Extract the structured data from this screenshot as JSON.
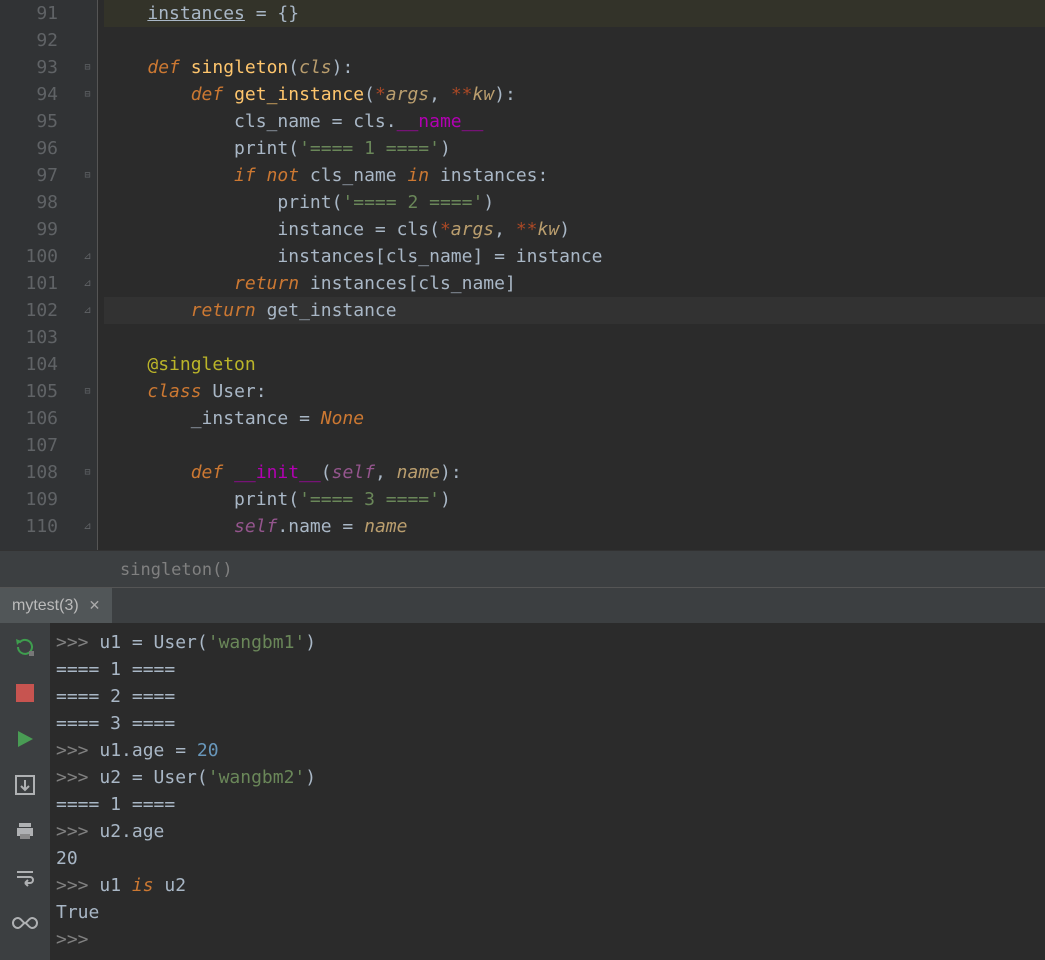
{
  "editor": {
    "lines": [
      {
        "n": 91,
        "fold": "",
        "tokens": [
          {
            "t": "    ",
            "c": ""
          },
          {
            "t": "instances",
            "c": "var und"
          },
          {
            "t": " = {}",
            "c": "op"
          }
        ],
        "hl": true
      },
      {
        "n": 92,
        "fold": "",
        "tokens": []
      },
      {
        "n": 93,
        "fold": "⊟",
        "tokens": [
          {
            "t": "    ",
            "c": ""
          },
          {
            "t": "def ",
            "c": "kw"
          },
          {
            "t": "singleton",
            "c": "def"
          },
          {
            "t": "(",
            "c": "op"
          },
          {
            "t": "cls",
            "c": "pname"
          },
          {
            "t": "):",
            "c": "op"
          }
        ]
      },
      {
        "n": 94,
        "fold": "⊟",
        "tokens": [
          {
            "t": "        ",
            "c": ""
          },
          {
            "t": "def ",
            "c": "kw"
          },
          {
            "t": "get_instance",
            "c": "def"
          },
          {
            "t": "(",
            "c": "op"
          },
          {
            "t": "*",
            "c": "par"
          },
          {
            "t": "args",
            "c": "pname"
          },
          {
            "t": ", ",
            "c": "op"
          },
          {
            "t": "**",
            "c": "par"
          },
          {
            "t": "kw",
            "c": "pname"
          },
          {
            "t": "):",
            "c": "op"
          }
        ]
      },
      {
        "n": 95,
        "fold": "",
        "tokens": [
          {
            "t": "            cls_name = cls.",
            "c": "var"
          },
          {
            "t": "__name__",
            "c": "fn"
          }
        ]
      },
      {
        "n": 96,
        "fold": "",
        "tokens": [
          {
            "t": "            ",
            "c": ""
          },
          {
            "t": "print",
            "c": "call"
          },
          {
            "t": "(",
            "c": "op"
          },
          {
            "t": "'==== 1 ===='",
            "c": "str"
          },
          {
            "t": ")",
            "c": "op"
          }
        ]
      },
      {
        "n": 97,
        "fold": "⊟",
        "tokens": [
          {
            "t": "            ",
            "c": ""
          },
          {
            "t": "if not ",
            "c": "kw"
          },
          {
            "t": "cls_name ",
            "c": "var"
          },
          {
            "t": "in ",
            "c": "kw"
          },
          {
            "t": "instances:",
            "c": "var"
          }
        ]
      },
      {
        "n": 98,
        "fold": "",
        "tokens": [
          {
            "t": "                ",
            "c": ""
          },
          {
            "t": "print",
            "c": "call"
          },
          {
            "t": "(",
            "c": "op"
          },
          {
            "t": "'==== 2 ===='",
            "c": "str"
          },
          {
            "t": ")",
            "c": "op"
          }
        ]
      },
      {
        "n": 99,
        "fold": "",
        "tokens": [
          {
            "t": "                instance = cls(",
            "c": "var"
          },
          {
            "t": "*",
            "c": "par"
          },
          {
            "t": "args",
            "c": "pname"
          },
          {
            "t": ", ",
            "c": "op"
          },
          {
            "t": "**",
            "c": "par"
          },
          {
            "t": "kw",
            "c": "pname"
          },
          {
            "t": ")",
            "c": "op"
          }
        ]
      },
      {
        "n": 100,
        "fold": "⊿",
        "tokens": [
          {
            "t": "                instances[cls_name] = instance",
            "c": "var"
          }
        ]
      },
      {
        "n": 101,
        "fold": "⊿",
        "tokens": [
          {
            "t": "            ",
            "c": ""
          },
          {
            "t": "return ",
            "c": "kw"
          },
          {
            "t": "instances[cls_name]",
            "c": "var"
          }
        ]
      },
      {
        "n": 102,
        "fold": "⊿",
        "tokens": [
          {
            "t": "        ",
            "c": ""
          },
          {
            "t": "return ",
            "c": "kw"
          },
          {
            "t": "get_instance",
            "c": "var"
          }
        ],
        "cur": true
      },
      {
        "n": 103,
        "fold": "",
        "tokens": []
      },
      {
        "n": 104,
        "fold": "",
        "tokens": [
          {
            "t": "    ",
            "c": ""
          },
          {
            "t": "@singleton",
            "c": "dec"
          }
        ]
      },
      {
        "n": 105,
        "fold": "⊟",
        "tokens": [
          {
            "t": "    ",
            "c": ""
          },
          {
            "t": "class ",
            "c": "kw"
          },
          {
            "t": "User",
            "c": "cls"
          },
          {
            "t": ":",
            "c": "op"
          }
        ]
      },
      {
        "n": 106,
        "fold": "",
        "tokens": [
          {
            "t": "        _instance = ",
            "c": "var"
          },
          {
            "t": "None",
            "c": "none"
          }
        ]
      },
      {
        "n": 107,
        "fold": "",
        "tokens": []
      },
      {
        "n": 108,
        "fold": "⊟",
        "tokens": [
          {
            "t": "        ",
            "c": ""
          },
          {
            "t": "def ",
            "c": "kw"
          },
          {
            "t": "__init__",
            "c": "fn"
          },
          {
            "t": "(",
            "c": "op"
          },
          {
            "t": "self",
            "c": "self"
          },
          {
            "t": ", ",
            "c": "op"
          },
          {
            "t": "name",
            "c": "pname"
          },
          {
            "t": "):",
            "c": "op"
          }
        ]
      },
      {
        "n": 109,
        "fold": "",
        "tokens": [
          {
            "t": "            ",
            "c": ""
          },
          {
            "t": "print",
            "c": "call"
          },
          {
            "t": "(",
            "c": "op"
          },
          {
            "t": "'==== 3 ===='",
            "c": "str"
          },
          {
            "t": ")",
            "c": "op"
          }
        ]
      },
      {
        "n": 110,
        "fold": "⊿",
        "tokens": [
          {
            "t": "            ",
            "c": ""
          },
          {
            "t": "self",
            "c": "self"
          },
          {
            "t": ".name = ",
            "c": "var"
          },
          {
            "t": "name",
            "c": "pname"
          }
        ]
      }
    ]
  },
  "breadcrumb": "singleton()",
  "tab": {
    "label": "mytest(3)",
    "close": "✕"
  },
  "toolbar_icons": [
    "rerun-icon",
    "stop-icon",
    "play-icon",
    "layout-icon",
    "print-icon",
    "wrap-icon",
    "infinite-icon"
  ],
  "console": {
    "lines": [
      [
        {
          "t": ">>> ",
          "c": "prompt"
        },
        {
          "t": "u1 = User(",
          "c": ""
        },
        {
          "t": "'wangbm1'",
          "c": "c-str"
        },
        {
          "t": ")",
          "c": ""
        }
      ],
      [
        {
          "t": "==== 1 ====",
          "c": ""
        }
      ],
      [
        {
          "t": "==== 2 ====",
          "c": ""
        }
      ],
      [
        {
          "t": "==== 3 ====",
          "c": ""
        }
      ],
      [
        {
          "t": ">>> ",
          "c": "prompt"
        },
        {
          "t": "u1.age = ",
          "c": ""
        },
        {
          "t": "20",
          "c": "c-num"
        }
      ],
      [
        {
          "t": ">>> ",
          "c": "prompt"
        },
        {
          "t": "u2 = User(",
          "c": ""
        },
        {
          "t": "'wangbm2'",
          "c": "c-str"
        },
        {
          "t": ")",
          "c": ""
        }
      ],
      [
        {
          "t": "==== 1 ====",
          "c": ""
        }
      ],
      [
        {
          "t": ">>> ",
          "c": "prompt"
        },
        {
          "t": "u2.age",
          "c": ""
        }
      ],
      [
        {
          "t": "20",
          "c": ""
        }
      ],
      [
        {
          "t": ">>> ",
          "c": "prompt"
        },
        {
          "t": "u1 ",
          "c": ""
        },
        {
          "t": "is ",
          "c": "c-kw"
        },
        {
          "t": "u2",
          "c": ""
        }
      ],
      [
        {
          "t": "True",
          "c": ""
        }
      ],
      [
        {
          "t": ">>> ",
          "c": "prompt"
        }
      ]
    ]
  }
}
